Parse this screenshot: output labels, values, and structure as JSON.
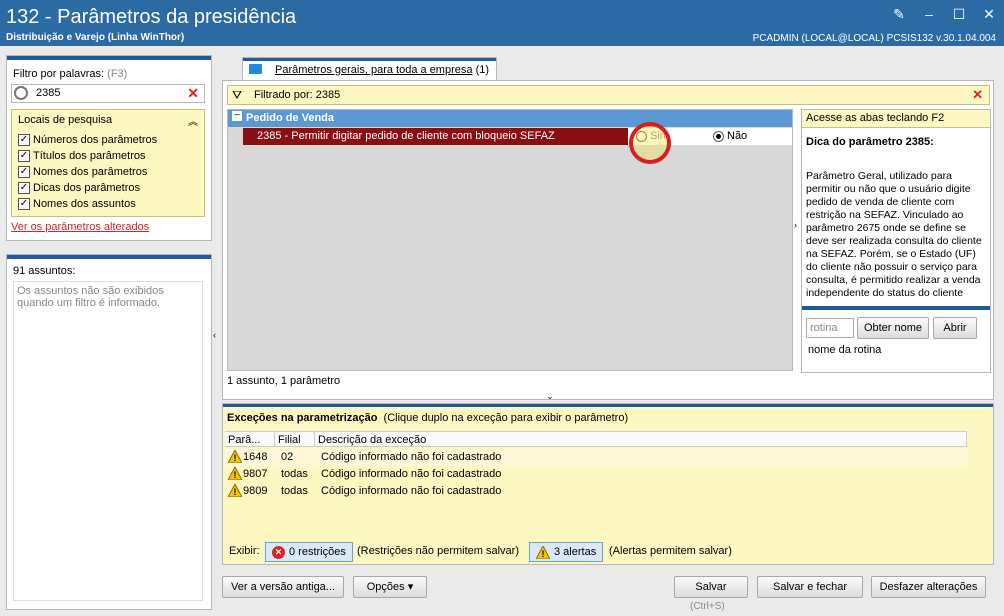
{
  "window": {
    "title": "132 - Parâmetros da presidência",
    "subtitle": "Distribuição e Varejo (Linha WinThor)",
    "user": "PCADMIN (LOCAL@LOCAL)   PCSIS132  v.30.1.04.004"
  },
  "filter_panel": {
    "label": "Filtro por palavras:",
    "shortcut": "(F3)",
    "search_value": "2385",
    "locais_title": "Locais de pesquisa",
    "options": [
      "Números dos parâmetros",
      "Títulos dos parâmetros",
      "Nomes dos parâmetros",
      "Dicas dos parâmetros",
      "Nomes dos assuntos"
    ],
    "changed_link": "Ver os parâmetros alterados"
  },
  "subjects_panel": {
    "count": "91 assuntos:",
    "info": "Os assuntos não são exibidos quando um filtro é informado."
  },
  "tab": {
    "label": "Parâmetros gerais, para toda a empresa",
    "count": "(1)"
  },
  "filter_bar": {
    "text": "Filtrado por: 2385"
  },
  "grid": {
    "group": "Pedido de Venda",
    "param": "2385 - Permitir digitar pedido de cliente com bloqueio SEFAZ",
    "opt_yes": "Sim",
    "opt_no": "Não",
    "selected": "Não",
    "status": "1 assunto, 1 parâmetro"
  },
  "side": {
    "shortcut_hint": "Acesse as abas teclando F2",
    "tip_title": "Dica do parâmetro 2385:",
    "tip_text": "Parâmetro Geral, utilizado para permitir ou não que o usuário digite pedido de venda de cliente com restrição na SEFAZ. Vinculado ao parâmetro 2675 onde se define se deve ser realizada consulta do cliente na SEFAZ. Porém, se o Estado (UF) do cliente não possuir o serviço para consulta, é permitido realizar a venda independente do status do cliente",
    "rotina_placeholder": "rotina",
    "get_name": "Obter nome",
    "open": "Abrir",
    "rotina_name": "nome da rotina"
  },
  "exceptions": {
    "title": "Exceções na parametrização",
    "hint": "(Clique duplo na exceção para exibir o parâmetro)",
    "columns": [
      "Parâ...",
      "Filial",
      "Descrição da exceção"
    ],
    "rows": [
      {
        "param": "1648",
        "filial": "02",
        "desc": "Código informado não foi cadastrado"
      },
      {
        "param": "9807",
        "filial": "todas",
        "desc": "Código informado não foi cadastrado"
      },
      {
        "param": "9809",
        "filial": "todas",
        "desc": "Código informado não foi cadastrado"
      }
    ],
    "show_label": "Exibir:",
    "restrictions": "0 restrições",
    "restrictions_note": "(Restrições não permitem salvar)",
    "alerts": "3 alertas",
    "alerts_note": "(Alertas permitem salvar)"
  },
  "footer": {
    "old_version": "Ver a versão antiga...",
    "options": "Opções",
    "save": "Salvar",
    "save_shortcut": "(Ctrl+S)",
    "save_close": "Salvar e fechar",
    "undo": "Desfazer alterações"
  },
  "colors": {
    "titlebar": "#2c6aa4",
    "group": "#5b99d4",
    "selected_row": "#8b0e11",
    "highlight": "#fdf7c2"
  }
}
